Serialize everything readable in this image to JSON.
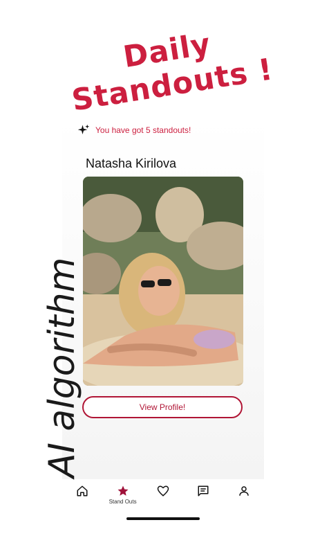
{
  "headline": {
    "line1": "Daily",
    "line2": "Standouts !"
  },
  "side_text": "AI algorithm",
  "banner": {
    "icon": "sparkle-icon",
    "text": "You have got 5 standouts!"
  },
  "profile": {
    "name": "Natasha Kirilova"
  },
  "actions": {
    "view_profile": "View Profile!"
  },
  "nav": {
    "items": [
      {
        "icon": "home-icon",
        "label": ""
      },
      {
        "icon": "star-icon",
        "label": "Stand Outs",
        "active": true
      },
      {
        "icon": "heart-icon",
        "label": ""
      },
      {
        "icon": "chat-icon",
        "label": ""
      },
      {
        "icon": "user-icon",
        "label": ""
      }
    ]
  },
  "colors": {
    "accent": "#cc1f3f",
    "button_border": "#b01535"
  }
}
